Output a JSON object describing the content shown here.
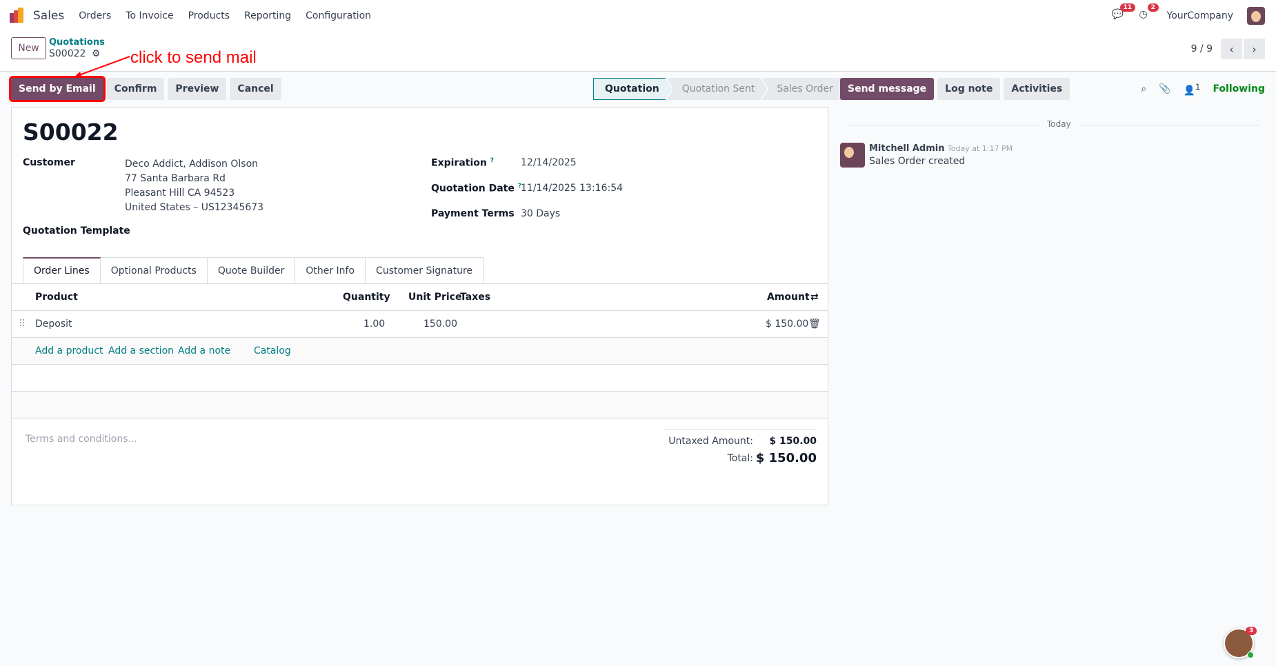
{
  "nav": {
    "app": "Sales",
    "items": [
      "Orders",
      "To Invoice",
      "Products",
      "Reporting",
      "Configuration"
    ],
    "messages_badge": "11",
    "activities_badge": "2",
    "company": "YourCompany"
  },
  "breadcrumb": {
    "new_label": "New",
    "parent": "Quotations",
    "current": "S00022"
  },
  "pager": {
    "value": "9 / 9"
  },
  "annotation": "click to send mail",
  "actions": {
    "send_email": "Send by Email",
    "confirm": "Confirm",
    "preview": "Preview",
    "cancel": "Cancel"
  },
  "statusbar": [
    "Quotation",
    "Quotation Sent",
    "Sales Order"
  ],
  "form": {
    "name": "S00022",
    "customer_label": "Customer",
    "customer_lines": [
      "Deco Addict, Addison Olson",
      "77 Santa Barbara Rd",
      "Pleasant Hill CA 94523",
      "United States – US12345673"
    ],
    "template_label": "Quotation Template",
    "expiration_label": "Expiration",
    "expiration": "12/14/2025",
    "qdate_label": "Quotation Date",
    "qdate": "11/14/2025 13:16:54",
    "terms_label": "Payment Terms",
    "terms": "30 Days",
    "help": "?"
  },
  "tabs": [
    "Order Lines",
    "Optional Products",
    "Quote Builder",
    "Other Info",
    "Customer Signature"
  ],
  "table": {
    "headers": {
      "product": "Product",
      "quantity": "Quantity",
      "unit_price": "Unit Price",
      "taxes": "Taxes",
      "amount": "Amount"
    },
    "rows": [
      {
        "product": "Deposit",
        "quantity": "1.00",
        "unit_price": "150.00",
        "amount": "$ 150.00"
      }
    ],
    "links": [
      "Add a product",
      "Add a section",
      "Add a note",
      "Catalog"
    ]
  },
  "footer": {
    "terms_placeholder": "Terms and conditions...",
    "untaxed_label": "Untaxed Amount:",
    "untaxed": "$ 150.00",
    "total_label": "Total:",
    "total": "$ 150.00"
  },
  "chatter": {
    "send_message": "Send message",
    "log_note": "Log note",
    "activities": "Activities",
    "followers": "1",
    "following": "Following",
    "date_sep": "Today",
    "message": {
      "author": "Mitchell Admin",
      "time": "Today at 1:17 PM",
      "body": "Sales Order created"
    }
  },
  "livechat_badge": "3",
  "colors": {
    "brand": "#714b67",
    "link": "#017e84",
    "following": "#008818",
    "annotation": "#ff0000"
  }
}
